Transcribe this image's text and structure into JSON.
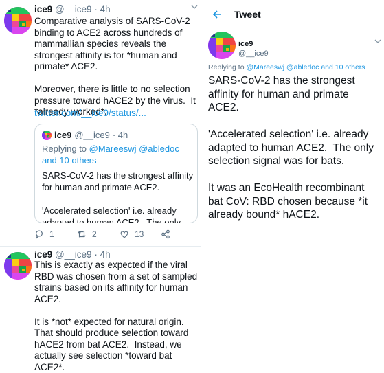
{
  "colors": {
    "accent": "#1b95e0",
    "muted": "#5b7083",
    "text": "#0f1419",
    "border": "#cfd9de"
  },
  "tweet1": {
    "name": "ice9",
    "handle": "@__ice9",
    "time": "· 4h",
    "text": "Comparative analysis of SARS-CoV-2 binding to ACE2 across hundreds of mammallian species reveals the strongest affinity is for *human and primate* ACE2.\n\nMoreover, there is little to no selection pressure toward hACE2 by the virus.  It *already worked*.",
    "link": "twitter.com/__ice9/status/...",
    "quote": {
      "name": "ice9",
      "handle": "@__ice9",
      "time": "· 4h",
      "reply_prefix": "Replying to ",
      "reply_mentions": "@Mareeswj @abledoc",
      "reply_suffix": " and 10 others",
      "text": "SARS-CoV-2 has the strongest affinity for human and primate ACE2.\n\n'Accelerated selection' i.e. already adapted to human ACE2.  The only selec..."
    },
    "actions": {
      "replies": "1",
      "retweets": "2",
      "likes": "13"
    }
  },
  "tweet2": {
    "name": "ice9",
    "handle": "@__ice9",
    "time": "· 4h",
    "text": "This is exactly as expected if the viral RBD was chosen from a set of sampled strains based on its affinity for human ACE2.\n\nIt is *not* expected for natural origin.  That should produce selection toward hACE2 from bat ACE2.  Instead, we actually see selection *toward bat ACE2*."
  },
  "detail": {
    "title": "Tweet",
    "name": "ice9",
    "handle": "@__ice9",
    "reply_prefix": "Replying to ",
    "reply_mentions": "@Mareeswj @abledoc",
    "reply_suffix": " and 10 others",
    "text": "SARS-CoV-2 has the strongest affinity for human and primate ACE2.\n\n'Accelerated selection' i.e. already adapted to human ACE2.  The only selection signal was for bats.\n\nIt was an EcoHealth recombinant bat CoV: RBD chosen because *it already bound* hACE2."
  }
}
